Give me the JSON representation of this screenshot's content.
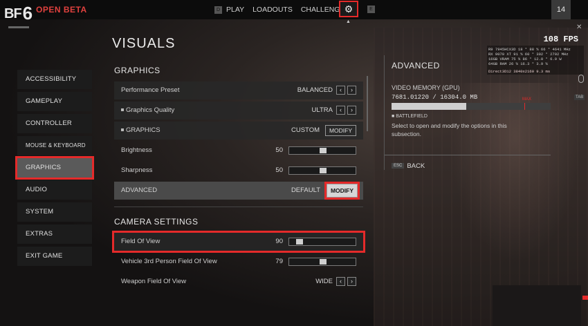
{
  "topbar": {
    "logo": "BF",
    "logo_num": "6",
    "beta": "OPEN BETA",
    "key_left": "D",
    "key_right": "E",
    "nav": [
      "PLAY",
      "LOADOUTS",
      "CHALLENGES"
    ],
    "level": "14",
    "accent": "#e52a2a"
  },
  "page_title": "VISUALS",
  "sidebar": {
    "items": [
      "ACCESSIBILITY",
      "GAMEPLAY",
      "CONTROLLER",
      "MOUSE & KEYBOARD",
      "GRAPHICS",
      "AUDIO",
      "SYSTEM",
      "EXTRAS",
      "EXIT GAME"
    ],
    "selected": "GRAPHICS"
  },
  "graphics": {
    "heading": "GRAPHICS",
    "preset_label": "Performance Preset",
    "preset_value": "BALANCED",
    "quality_label": "Graphics Quality",
    "quality_value": "ULTRA",
    "gfx_label": "GRAPHICS",
    "gfx_value": "CUSTOM",
    "gfx_button": "MODIFY",
    "brightness_label": "Brightness",
    "brightness_value": "50",
    "brightness_fraction": 0.5,
    "sharpness_label": "Sharpness",
    "sharpness_value": "50",
    "sharpness_fraction": 0.5,
    "advanced_label": "ADVANCED",
    "advanced_value": "DEFAULT",
    "advanced_button": "MODIFY"
  },
  "camera": {
    "heading": "CAMERA SETTINGS",
    "fov_label": "Field Of View",
    "fov_value": "90",
    "fov_fraction": 0.1,
    "veh_label": "Vehicle 3rd Person Field Of View",
    "veh_value": "79",
    "veh_fraction": 0.5,
    "weapon_label": "Weapon Field Of View",
    "weapon_value": "WIDE"
  },
  "advanced_panel": {
    "heading": "ADVANCED",
    "mem_label": "VIDEO MEMORY (GPU)",
    "mem_value": "7681.01220 / 16304.0 MB",
    "mem_fraction": 0.47,
    "max_label": "MAX",
    "battlefield_label": "BATTLEFIELD",
    "description": "Select to open and modify the options in this subsection.",
    "esc_key": "ESC",
    "back_label": "BACK"
  },
  "overlay": {
    "fps": "108 FPS",
    "stats_lines": [
      "R9 7945HCX3D 18 °   88 %   66 °  4641 MHz",
      "RX 9070 XT   91 %   60 °  302 °  2702 MHz",
      "16GB VRAM    75 %   86 °  12.0 °  6.9 W",
      "64GB RAM     26 %          16.3 °  3.9 %"
    ],
    "api": "Direct3D12 3840x2160     9.3 ms",
    "tab_key": "TAB"
  }
}
